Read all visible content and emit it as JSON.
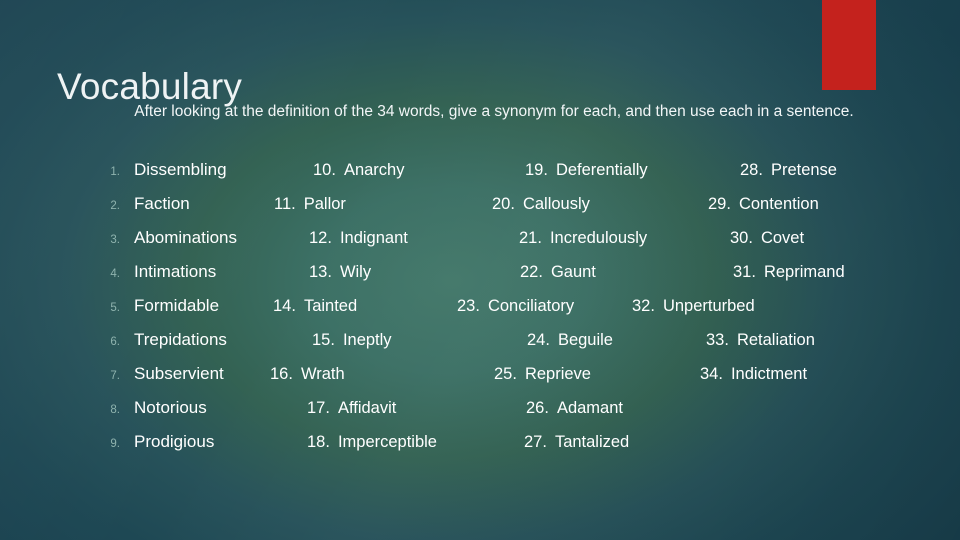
{
  "slide": {
    "title": "Vocabulary",
    "subtitle": "After looking at the definition of the 34 words, give a synonym for each, and then use each in a sentence.",
    "accent_color": "#c4221d",
    "background_center_color": "#43786a",
    "background_edge_color": "#19414f",
    "text_color": "#ffffff",
    "number_muted_color": "#8fb3ae"
  },
  "word_list": {
    "total_words": 34,
    "columns": [
      {
        "name": "column-1",
        "items": [
          {
            "number": "1.",
            "word": "Dissembling"
          },
          {
            "number": "2.",
            "word": "Faction"
          },
          {
            "number": "3.",
            "word": "Abominations"
          },
          {
            "number": "4.",
            "word": "Intimations"
          },
          {
            "number": "5.",
            "word": "Formidable"
          },
          {
            "number": "6.",
            "word": "Trepidations"
          },
          {
            "number": "7.",
            "word": "Subservient"
          },
          {
            "number": "8.",
            "word": "Notorious"
          },
          {
            "number": "9.",
            "word": "Prodigious"
          }
        ]
      },
      {
        "name": "column-2",
        "items": [
          {
            "number": "10.",
            "word": "Anarchy"
          },
          {
            "number": "11.",
            "word": "Pallor"
          },
          {
            "number": "12.",
            "word": "Indignant"
          },
          {
            "number": "13.",
            "word": "Wily"
          },
          {
            "number": "14.",
            "word": "Tainted"
          },
          {
            "number": "15.",
            "word": "Ineptly"
          },
          {
            "number": "16.",
            "word": "Wrath"
          },
          {
            "number": "17.",
            "word": "Affidavit"
          },
          {
            "number": "18.",
            "word": "Imperceptible"
          }
        ]
      },
      {
        "name": "column-3",
        "items": [
          {
            "number": "19.",
            "word": "Deferentially"
          },
          {
            "number": "20.",
            "word": "Callously"
          },
          {
            "number": "21.",
            "word": "Incredulously"
          },
          {
            "number": "22.",
            "word": "Gaunt"
          },
          {
            "number": "23.",
            "word": "Conciliatory"
          },
          {
            "number": "24.",
            "word": "Beguile"
          },
          {
            "number": "25.",
            "word": "Reprieve"
          },
          {
            "number": "26.",
            "word": "Adamant"
          },
          {
            "number": "27.",
            "word": "Tantalized"
          }
        ]
      },
      {
        "name": "column-4",
        "items": [
          {
            "number": "28.",
            "word": "Pretense"
          },
          {
            "number": "29.",
            "word": "Contention"
          },
          {
            "number": "30.",
            "word": "Covet"
          },
          {
            "number": "31.",
            "word": "Reprimand"
          },
          {
            "number": "32.",
            "word": "Unperturbed"
          },
          {
            "number": "33.",
            "word": "Retaliation"
          },
          {
            "number": "34.",
            "word": "Indictment"
          },
          null,
          null
        ]
      }
    ],
    "row_offsets": [
      {
        "col1": 98,
        "col2": 313,
        "col3": 525,
        "col4": 740
      },
      {
        "col1": 98,
        "col2": 274,
        "col3": 492,
        "col4": 708
      },
      {
        "col1": 98,
        "col2": 309,
        "col3": 519,
        "col4": 730
      },
      {
        "col1": 98,
        "col2": 309,
        "col3": 520,
        "col4": 733
      },
      {
        "col1": 98,
        "col2": 273,
        "col3": 457,
        "col4": 632
      },
      {
        "col1": 98,
        "col2": 312,
        "col3": 527,
        "col4": 706
      },
      {
        "col1": 98,
        "col2": 270,
        "col3": 494,
        "col4": 700
      },
      {
        "col1": 98,
        "col2": 307,
        "col3": 526,
        "col4": null
      },
      {
        "col1": 98,
        "col2": 307,
        "col3": 524,
        "col4": null
      }
    ]
  }
}
